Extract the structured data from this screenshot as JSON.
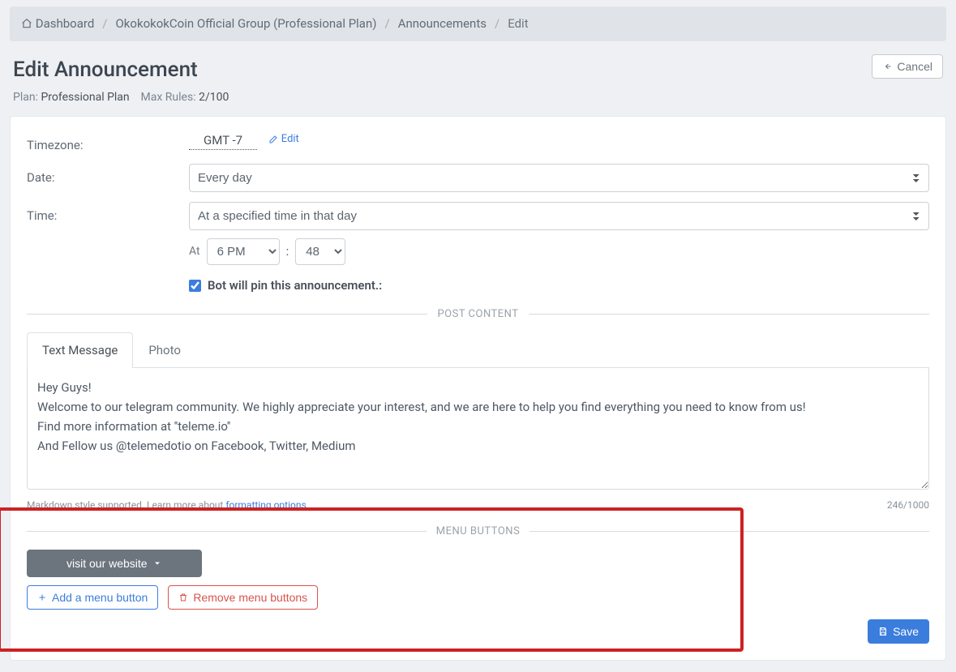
{
  "breadcrumb": {
    "home": "Dashboard",
    "group": "OkokokokCoin Official Group (Professional Plan)",
    "section": "Announcements",
    "current": "Edit"
  },
  "header": {
    "title": "Edit Announcement",
    "plan_prefix": "Plan: ",
    "plan_value": "Professional Plan",
    "maxrules_prefix": "Max Rules: ",
    "maxrules_value": "2/100",
    "cancel": "Cancel"
  },
  "form": {
    "timezone_label": "Timezone:",
    "timezone_value": "GMT -7",
    "timezone_edit": "Edit",
    "date_label": "Date:",
    "date_value": "Every day",
    "time_label": "Time:",
    "time_value": "At a specified time in that day",
    "at_label": "At",
    "hour_value": "6 PM",
    "minute_value": "48",
    "colon": ":",
    "pin_label": "Bot will pin this announcement.:"
  },
  "post": {
    "divider_label": "POST CONTENT",
    "tabs": {
      "text": "Text Message",
      "photo": "Photo"
    },
    "message": "Hey Guys!\nWelcome to our telegram community. We highly appreciate your interest, and we are here to help you find everything you need to know from us!\nFind more information at ''teleme.io''\nAnd Fellow us @telemedotio on Facebook, Twitter, Medium",
    "helper_prefix": "Markdown style supported. Learn more about ",
    "helper_link": "formatting options",
    "counter": "246/1000"
  },
  "menu": {
    "divider_label": "MENU BUTTONS",
    "existing_button": "visit our website",
    "add_label": "Add a menu button",
    "remove_label": "Remove menu buttons"
  },
  "footer": {
    "save": "Save"
  }
}
